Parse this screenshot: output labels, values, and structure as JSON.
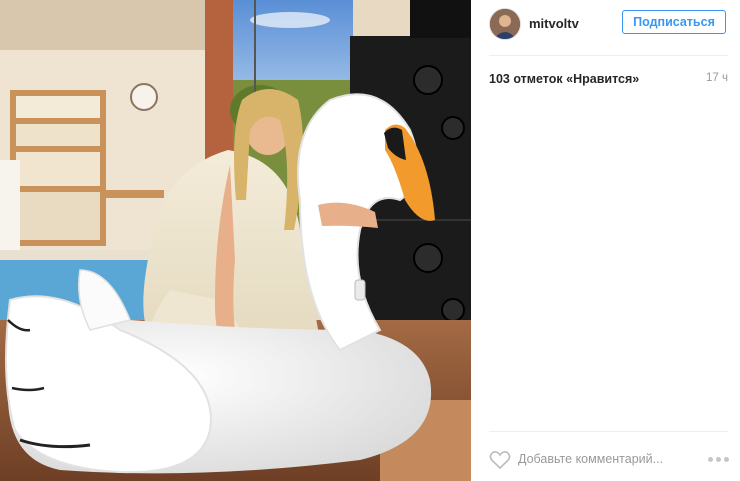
{
  "post": {
    "username": "mitvoltv",
    "follow_label": "Подписаться",
    "likes_text": "103 отметок «Нравится»",
    "time_ago": "17 ч",
    "comment_placeholder": "Добавьте комментарий..."
  },
  "colors": {
    "accent": "#3897f0",
    "text": "#262626",
    "muted": "#999999"
  },
  "icons": [
    "heart-icon",
    "more-options-icon"
  ]
}
